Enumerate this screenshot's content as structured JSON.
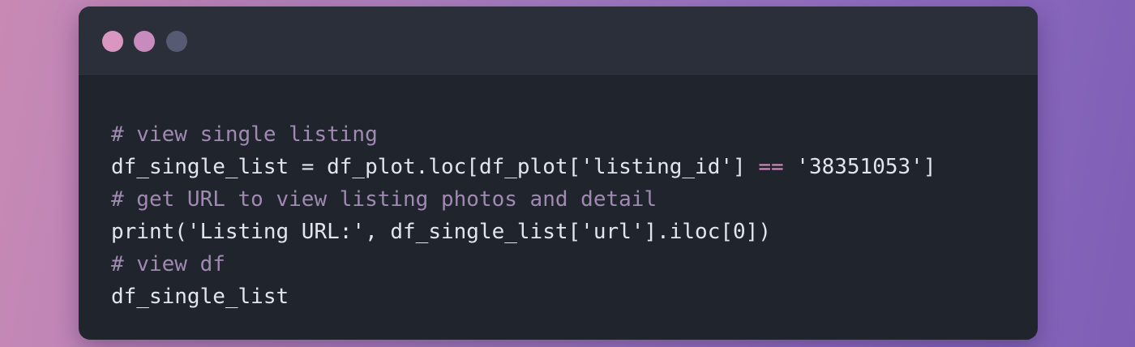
{
  "window": {
    "traffic_lights": [
      {
        "name": "close",
        "color": "#d996c0"
      },
      {
        "name": "minimize",
        "color": "#c88bbd"
      },
      {
        "name": "maximize",
        "color": "#565a73"
      }
    ]
  },
  "code": {
    "comment_color": "#a08ab1",
    "operator_color": "#d58bbd",
    "text_color": "#e3e5ec",
    "lines": [
      {
        "comment": "# view single listing"
      },
      {
        "before": "df_single_list = df_plot.loc[df_plot['listing_id'] ",
        "op": "==",
        "after": " '38351053']"
      },
      {
        "comment": "# get URL to view listing photos and detail"
      },
      {
        "text": "print('Listing URL:', df_single_list['url'].iloc[0])"
      },
      {
        "comment": "# view df"
      },
      {
        "text": "df_single_list"
      }
    ]
  }
}
